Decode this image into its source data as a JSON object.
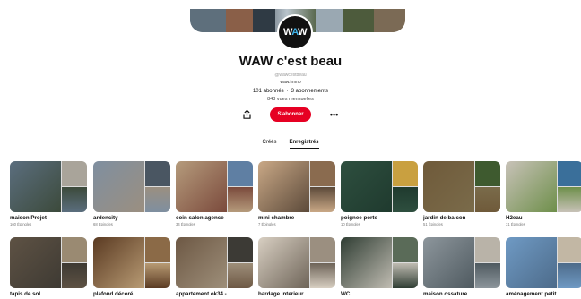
{
  "profile": {
    "name": "WAW c'est beau",
    "handle": "@wawcestbeau",
    "website": "waw.immo",
    "followers": "101 abonnés",
    "following": "3 abonnements",
    "separator": "·",
    "monthly_views": "843 vues mensuelles",
    "avatar_text_a": "W",
    "avatar_text_b": "A",
    "avatar_text_c": "W"
  },
  "actions": {
    "share_icon": "share-icon",
    "follow_label": "S'abonner",
    "more_label": "•••"
  },
  "tabs": [
    {
      "label": "Créés",
      "active": false
    },
    {
      "label": "Enregistrés",
      "active": true
    }
  ],
  "colors": {
    "brand_red": "#e60023",
    "avatar_bg": "#111111",
    "avatar_accent": "#3fb2e8"
  },
  "boards": [
    {
      "title": "maison Projet",
      "count": "160 Épingles",
      "c": [
        "#5b6e7e",
        "#a9a49a",
        "#3c4a3b"
      ]
    },
    {
      "title": "ardencity",
      "count": "68 Épingles",
      "c": [
        "#7f8fa0",
        "#4a5662",
        "#9b8f80"
      ]
    },
    {
      "title": "coin salon agence",
      "count": "34 Épingles",
      "c": [
        "#b59b7c",
        "#5f7fa3",
        "#7b4a3c"
      ]
    },
    {
      "title": "mini chambre",
      "count": "7 Épingles",
      "c": [
        "#c9a886",
        "#8a6b4f",
        "#5c4a3a"
      ]
    },
    {
      "title": "poignee porte",
      "count": "10 Épingles",
      "c": [
        "#2e4f3f",
        "#c9a040",
        "#1f3a2e"
      ]
    },
    {
      "title": "jardin de balcon",
      "count": "51 Épingles",
      "c": [
        "#6f5a3a",
        "#3e5a2f",
        "#7a6b4a"
      ]
    },
    {
      "title": "H2eau",
      "count": "31 Épingles",
      "c": [
        "#c8c2b8",
        "#3a6f9a",
        "#6e8f4a"
      ]
    },
    {
      "title": "tapis de sol",
      "count": "",
      "c": [
        "#5e5244",
        "#9a8a72",
        "#3e3a33"
      ]
    },
    {
      "title": "plafond décoré",
      "count": "",
      "c": [
        "#5a3a22",
        "#8b6a47",
        "#b89b74"
      ]
    },
    {
      "title": "appartement ok34 -...",
      "count": "",
      "c": [
        "#6d5844",
        "#3c3a35",
        "#9e8f7a"
      ]
    },
    {
      "title": "bardage interieur",
      "count": "",
      "c": [
        "#d8cfc2",
        "#9b8f80",
        "#6e6458"
      ]
    },
    {
      "title": "WC",
      "count": "",
      "c": [
        "#2f3d33",
        "#5a6b58",
        "#c0bcb2"
      ]
    },
    {
      "title": "maison ossature...",
      "count": "",
      "c": [
        "#8d969c",
        "#b9b3a8",
        "#4f5a60"
      ]
    },
    {
      "title": "aménagement petit...",
      "count": "",
      "c": [
        "#6f9ac4",
        "#c2b7a4",
        "#4d6b8a"
      ]
    }
  ]
}
